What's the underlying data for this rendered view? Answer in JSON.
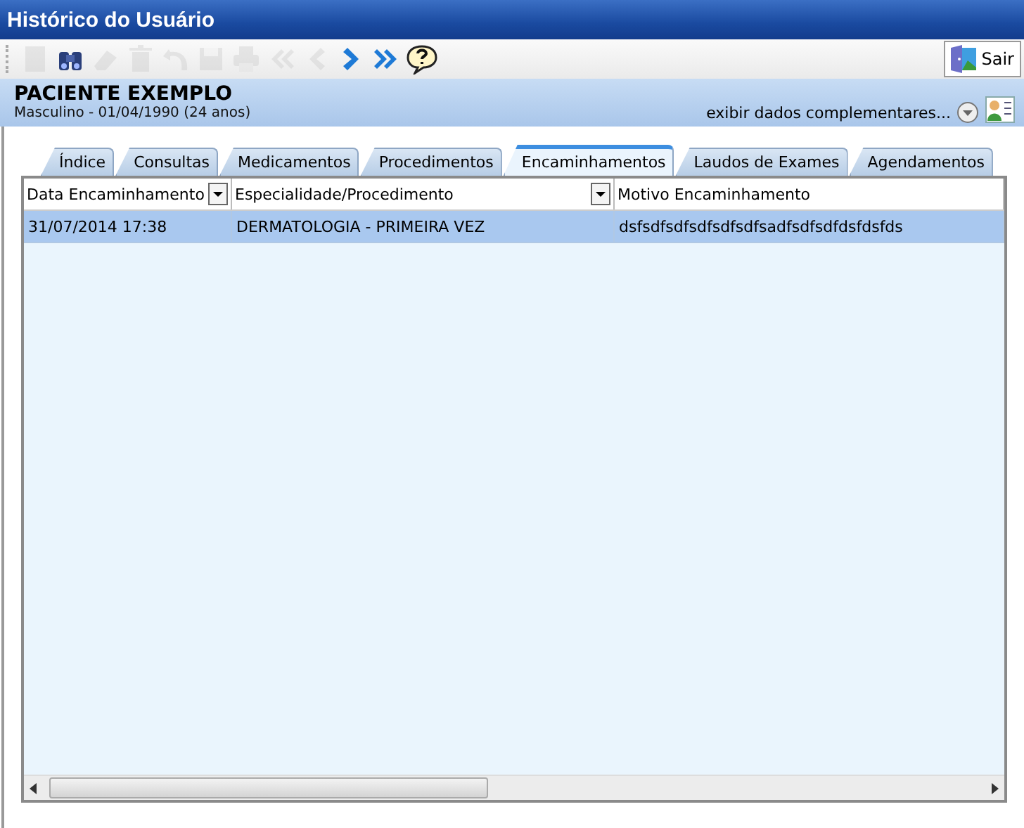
{
  "window": {
    "title": "Histórico do Usuário"
  },
  "toolbar": {
    "buttons": [
      {
        "kind": "new",
        "disabled": true
      },
      {
        "kind": "find",
        "disabled": false
      },
      {
        "kind": "erase",
        "disabled": true
      },
      {
        "kind": "delete",
        "disabled": true
      },
      {
        "kind": "undo",
        "disabled": true
      },
      {
        "kind": "save",
        "disabled": true
      },
      {
        "kind": "print",
        "disabled": true
      },
      {
        "kind": "first",
        "disabled": true
      },
      {
        "kind": "prev",
        "disabled": true
      },
      {
        "kind": "next",
        "disabled": false
      },
      {
        "kind": "last",
        "disabled": false
      },
      {
        "kind": "help",
        "disabled": false
      }
    ],
    "exit_label": "Sair"
  },
  "patient": {
    "name": "PACIENTE EXEMPLO",
    "details": "Masculino - 01/04/1990 (24 anos)",
    "more_link": "exibir dados complementares..."
  },
  "tabs": [
    {
      "label": "Índice",
      "selected": false
    },
    {
      "label": "Consultas",
      "selected": false
    },
    {
      "label": "Medicamentos",
      "selected": false
    },
    {
      "label": "Procedimentos",
      "selected": false
    },
    {
      "label": "Encaminhamentos",
      "selected": true
    },
    {
      "label": "Laudos de Exames",
      "selected": false
    },
    {
      "label": "Agendamentos",
      "selected": false
    }
  ],
  "table": {
    "columns": [
      {
        "label": "Data Encaminhamento",
        "filter": true
      },
      {
        "label": "Especialidade/Procedimento",
        "filter": true
      },
      {
        "label": "Motivo Encaminhamento",
        "filter": false
      }
    ],
    "rows": [
      {
        "cells": [
          "31/07/2014 17:38",
          "DERMATOLOGIA - PRIMEIRA VEZ",
          "dsfsdfsdfsdfsdfsdfsadfsdfsdfdsfdsfds"
        ],
        "selected": true
      }
    ]
  }
}
